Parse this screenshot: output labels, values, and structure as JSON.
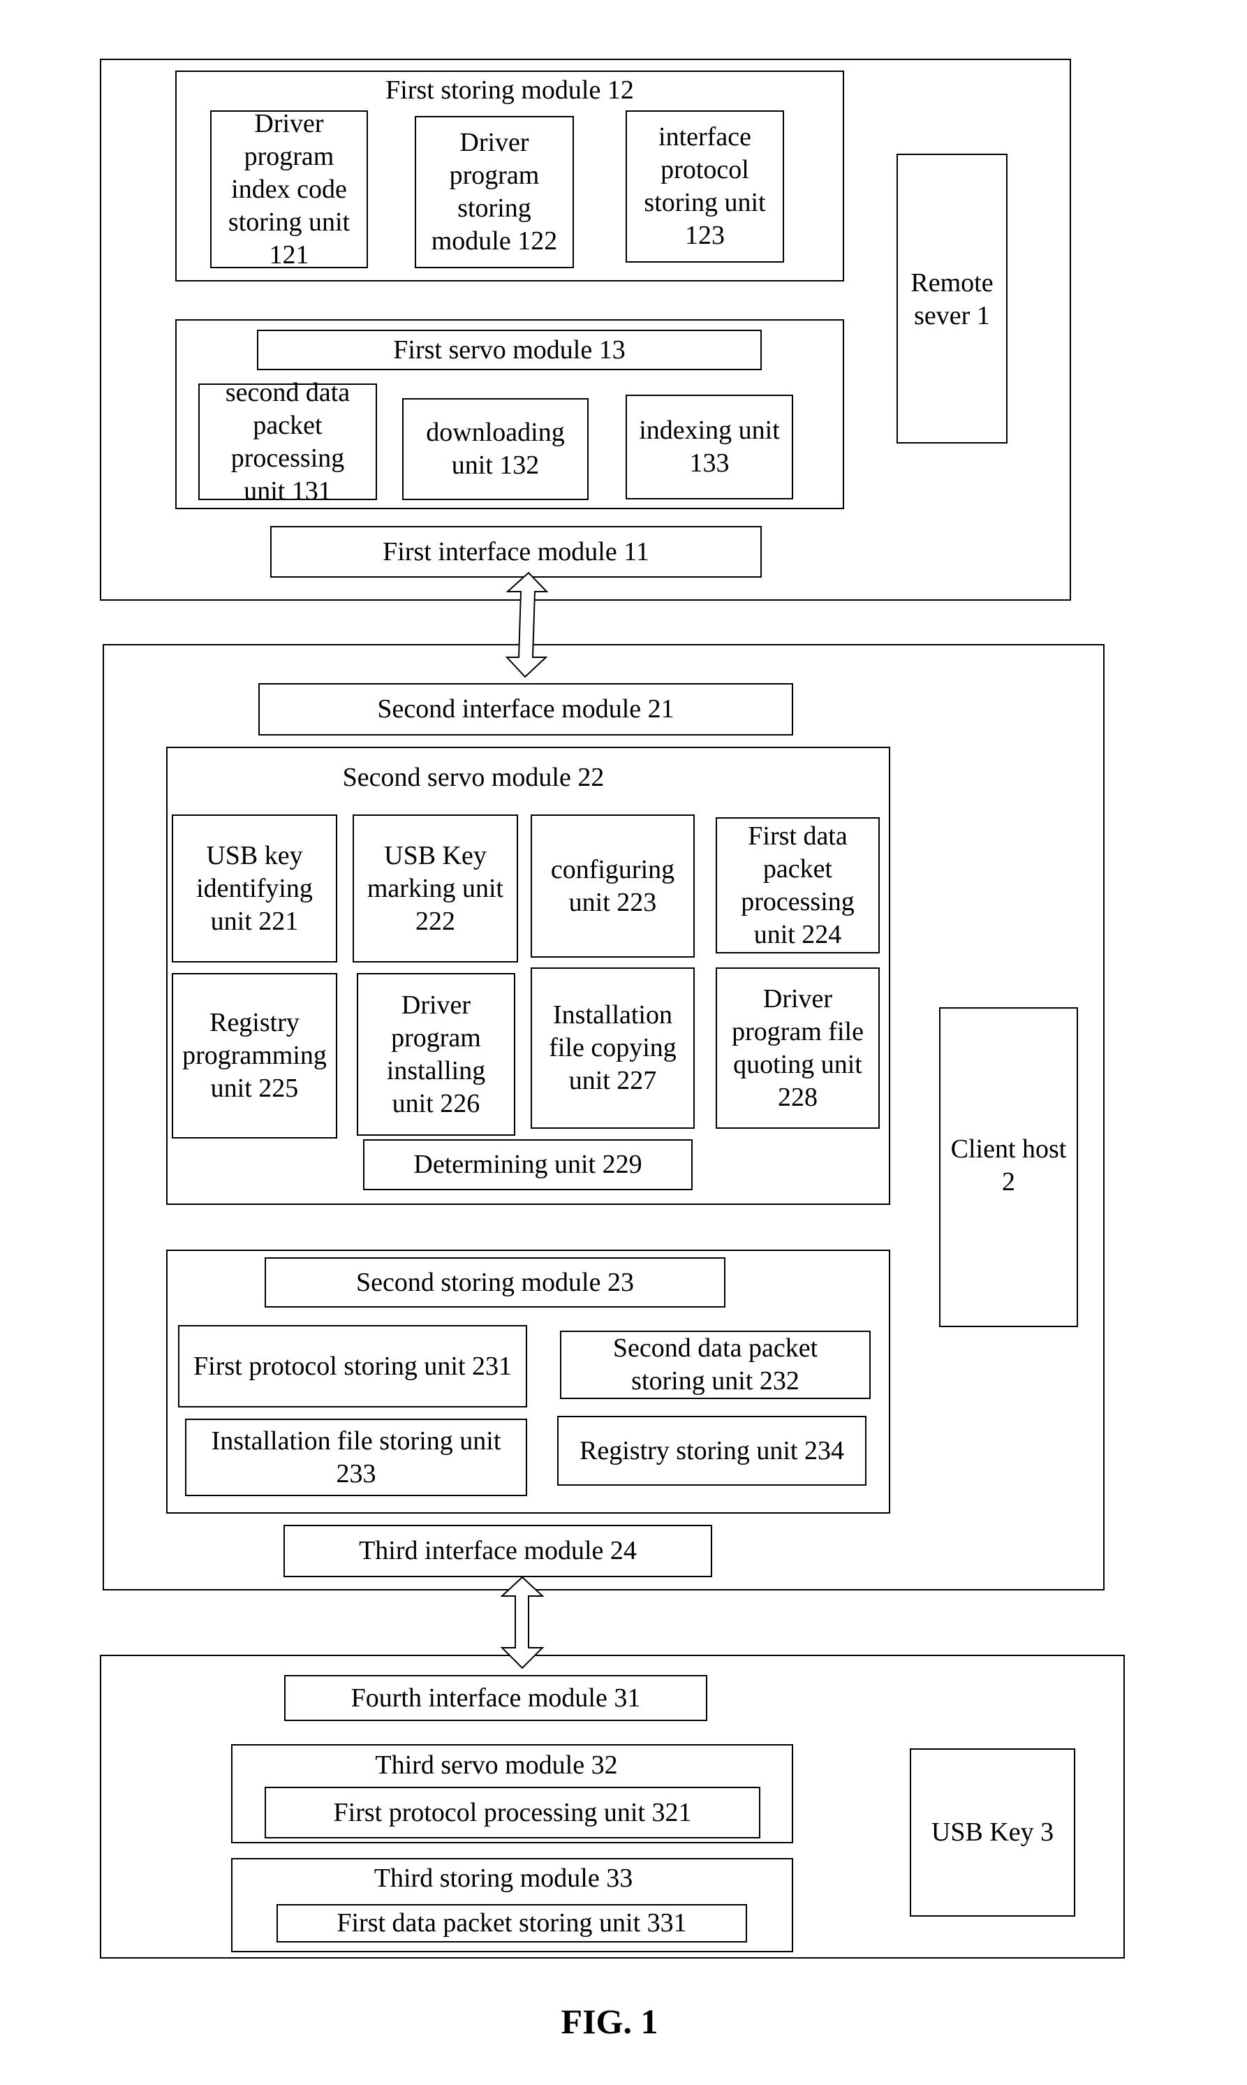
{
  "figure_label": "FIG. 1",
  "remote_server": {
    "label": "Remote\nsever 1",
    "first_storing_module": {
      "title": "First storing module 12",
      "units": [
        {
          "label": "Driver\nprogram\nindex code\nstoring unit\n121"
        },
        {
          "label": "Driver\nprogram\nstoring\nmodule 122"
        },
        {
          "label": "interface\nprotocol\nstoring unit\n123"
        }
      ]
    },
    "first_servo_module": {
      "title": "First servo module 13",
      "units": [
        {
          "label": "second data\npacket\nprocessing\nunit 131"
        },
        {
          "label": "downloading\nunit 132"
        },
        {
          "label": "indexing unit\n133"
        }
      ]
    },
    "first_interface_module": {
      "label": "First interface module 11"
    }
  },
  "client_host": {
    "label": "Client host\n2",
    "second_interface_module": {
      "label": "Second interface module 21"
    },
    "second_servo_module": {
      "title": "Second servo module 22",
      "units": [
        {
          "label": "USB key\nidentifying\nunit 221"
        },
        {
          "label": "USB Key\nmarking unit\n222"
        },
        {
          "label": "configuring\nunit 223"
        },
        {
          "label": "First data\npacket\nprocessing\nunit 224"
        },
        {
          "label": "Registry\nprogramming\nunit 225"
        },
        {
          "label": "Driver\nprogram\ninstalling\nunit 226"
        },
        {
          "label": "Installation\nfile copying\nunit 227"
        },
        {
          "label": "Driver\nprogram file\nquoting unit\n228"
        },
        {
          "label": "Determining unit 229"
        }
      ]
    },
    "second_storing_module": {
      "title": "Second storing module 23",
      "units": [
        {
          "label": "First protocol storing unit 231"
        },
        {
          "label": "Second data packet\nstoring unit 232"
        },
        {
          "label": "Installation file storing unit\n233"
        },
        {
          "label": "Registry storing unit 234"
        }
      ]
    },
    "third_interface_module": {
      "label": "Third interface module 24"
    }
  },
  "usb_key": {
    "label": "USB Key 3",
    "fourth_interface_module": {
      "label": "Fourth interface module 31"
    },
    "third_servo_module": {
      "title": "Third servo module 32",
      "units": [
        {
          "label": "First protocol processing unit 321"
        }
      ]
    },
    "third_storing_module": {
      "title": "Third storing module 33",
      "units": [
        {
          "label": "First data packet storing unit 331"
        }
      ]
    }
  },
  "connections": [
    {
      "from": "First interface module 11",
      "to": "Second interface module 21",
      "type": "bidirectional-arrow"
    },
    {
      "from": "Third interface module 24",
      "to": "Fourth interface module 31",
      "type": "bidirectional-arrow"
    }
  ]
}
